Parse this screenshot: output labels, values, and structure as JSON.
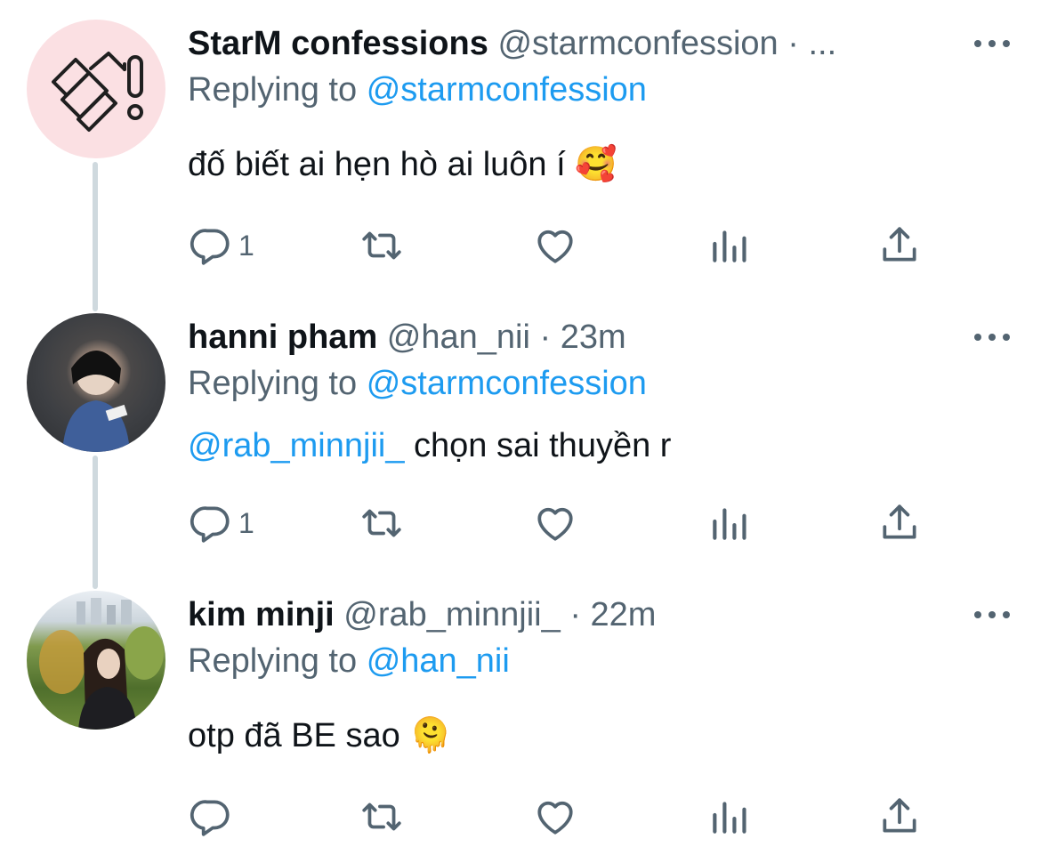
{
  "tweets": [
    {
      "name": "StarM confessions",
      "handle": "@starmconfession",
      "separator": "·",
      "time": "...",
      "replying_prefix": "Replying to",
      "replying_to": "@starmconfession",
      "text": "đố biết ai hẹn hò ai luôn í",
      "emoji": "🥰",
      "reply_count": "1",
      "avatar": "starm-logo"
    },
    {
      "name": "hanni pham",
      "handle": "@han_nii",
      "separator": "·",
      "time": "23m",
      "replying_prefix": "Replying to",
      "replying_to": "@starmconfession",
      "mention": "@rab_minnjii_",
      "text": "chọn sai thuyền r",
      "reply_count": "1",
      "avatar": "profile-photo"
    },
    {
      "name": "kim minji",
      "handle": "@rab_minnjii_",
      "separator": "·",
      "time": "22m",
      "replying_prefix": "Replying to",
      "replying_to": "@han_nii",
      "text": "otp đã BE sao",
      "emoji": "🫠",
      "reply_count": "",
      "avatar": "profile-photo"
    }
  ],
  "colors": {
    "link": "#1d9bf0",
    "secondary": "#536471",
    "thread_line": "#cfd9de",
    "starm_avatar_bg": "#fbe0e3"
  }
}
